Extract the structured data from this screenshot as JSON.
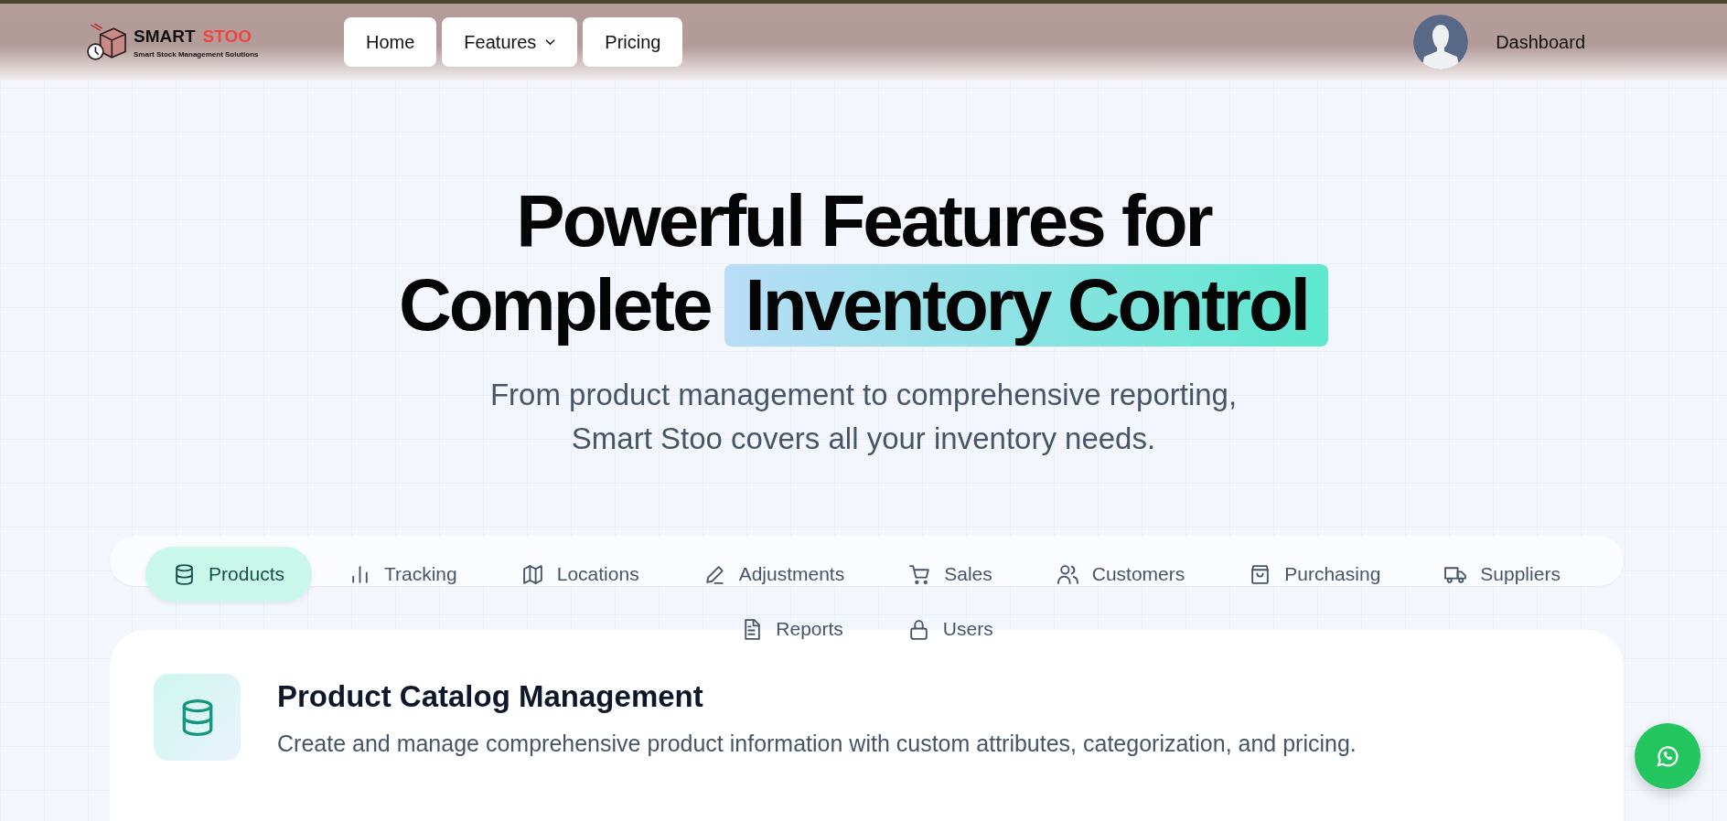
{
  "header": {
    "brand_first": "SMART",
    "brand_second": "STOO",
    "tagline": "Smart Stock Management Solutions",
    "nav": [
      {
        "label": "Home",
        "kind": "link"
      },
      {
        "label": "Features",
        "kind": "dropdown"
      },
      {
        "label": "Pricing",
        "kind": "link"
      }
    ],
    "dashboard": "Dashboard"
  },
  "hero": {
    "title_line1": "Powerful Features for",
    "title_line2": "Complete",
    "title_highlight": "Inventory Control",
    "subtitle_line1": "From product management to comprehensive reporting,",
    "subtitle_line2": "Smart Stoo covers all your inventory needs."
  },
  "tabs": [
    {
      "label": "Products",
      "selected": true
    },
    {
      "label": "Tracking",
      "selected": false
    },
    {
      "label": "Locations",
      "selected": false
    },
    {
      "label": "Adjustments",
      "selected": false
    },
    {
      "label": "Sales",
      "selected": false
    },
    {
      "label": "Customers",
      "selected": false
    },
    {
      "label": "Purchasing",
      "selected": false
    },
    {
      "label": "Suppliers",
      "selected": false
    },
    {
      "label": "Reports",
      "selected": false
    },
    {
      "label": "Users",
      "selected": false
    }
  ],
  "panel": {
    "title": "Product Catalog Management",
    "description": "Create and manage comprehensive product information with custom attributes, categorization, and pricing."
  }
}
